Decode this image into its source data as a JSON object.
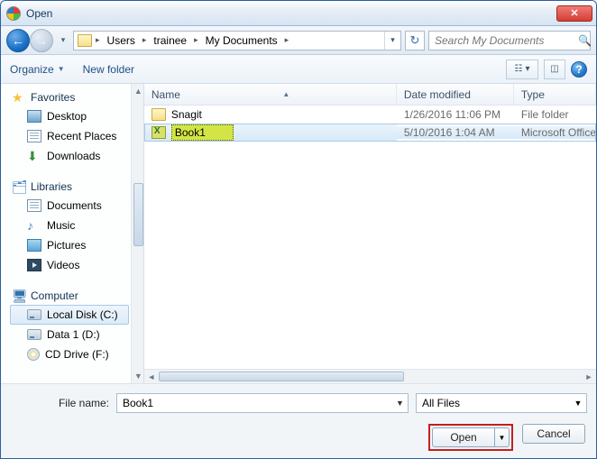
{
  "window": {
    "title": "Open"
  },
  "breadcrumb": {
    "segments": [
      "Users",
      "trainee",
      "My Documents"
    ]
  },
  "search": {
    "placeholder": "Search My Documents"
  },
  "toolbar": {
    "organize": "Organize",
    "newfolder": "New folder"
  },
  "sidebar": {
    "favorites": {
      "label": "Favorites",
      "items": [
        "Desktop",
        "Recent Places",
        "Downloads"
      ]
    },
    "libraries": {
      "label": "Libraries",
      "items": [
        "Documents",
        "Music",
        "Pictures",
        "Videos"
      ]
    },
    "computer": {
      "label": "Computer",
      "items": [
        "Local Disk (C:)",
        "Data 1 (D:)",
        "CD Drive (F:)"
      ]
    }
  },
  "columns": {
    "name": "Name",
    "date": "Date modified",
    "type": "Type"
  },
  "rows": [
    {
      "name": "Snagit",
      "date": "1/26/2016 11:06 PM",
      "type": "File folder",
      "kind": "folder",
      "selected": false
    },
    {
      "name": "Book1",
      "date": "5/10/2016 1:04 AM",
      "type": "Microsoft Office",
      "kind": "xls",
      "selected": true
    }
  ],
  "footer": {
    "filename_label": "File name:",
    "filename_value": "Book1",
    "filter": "All Files",
    "open": "Open",
    "cancel": "Cancel"
  }
}
